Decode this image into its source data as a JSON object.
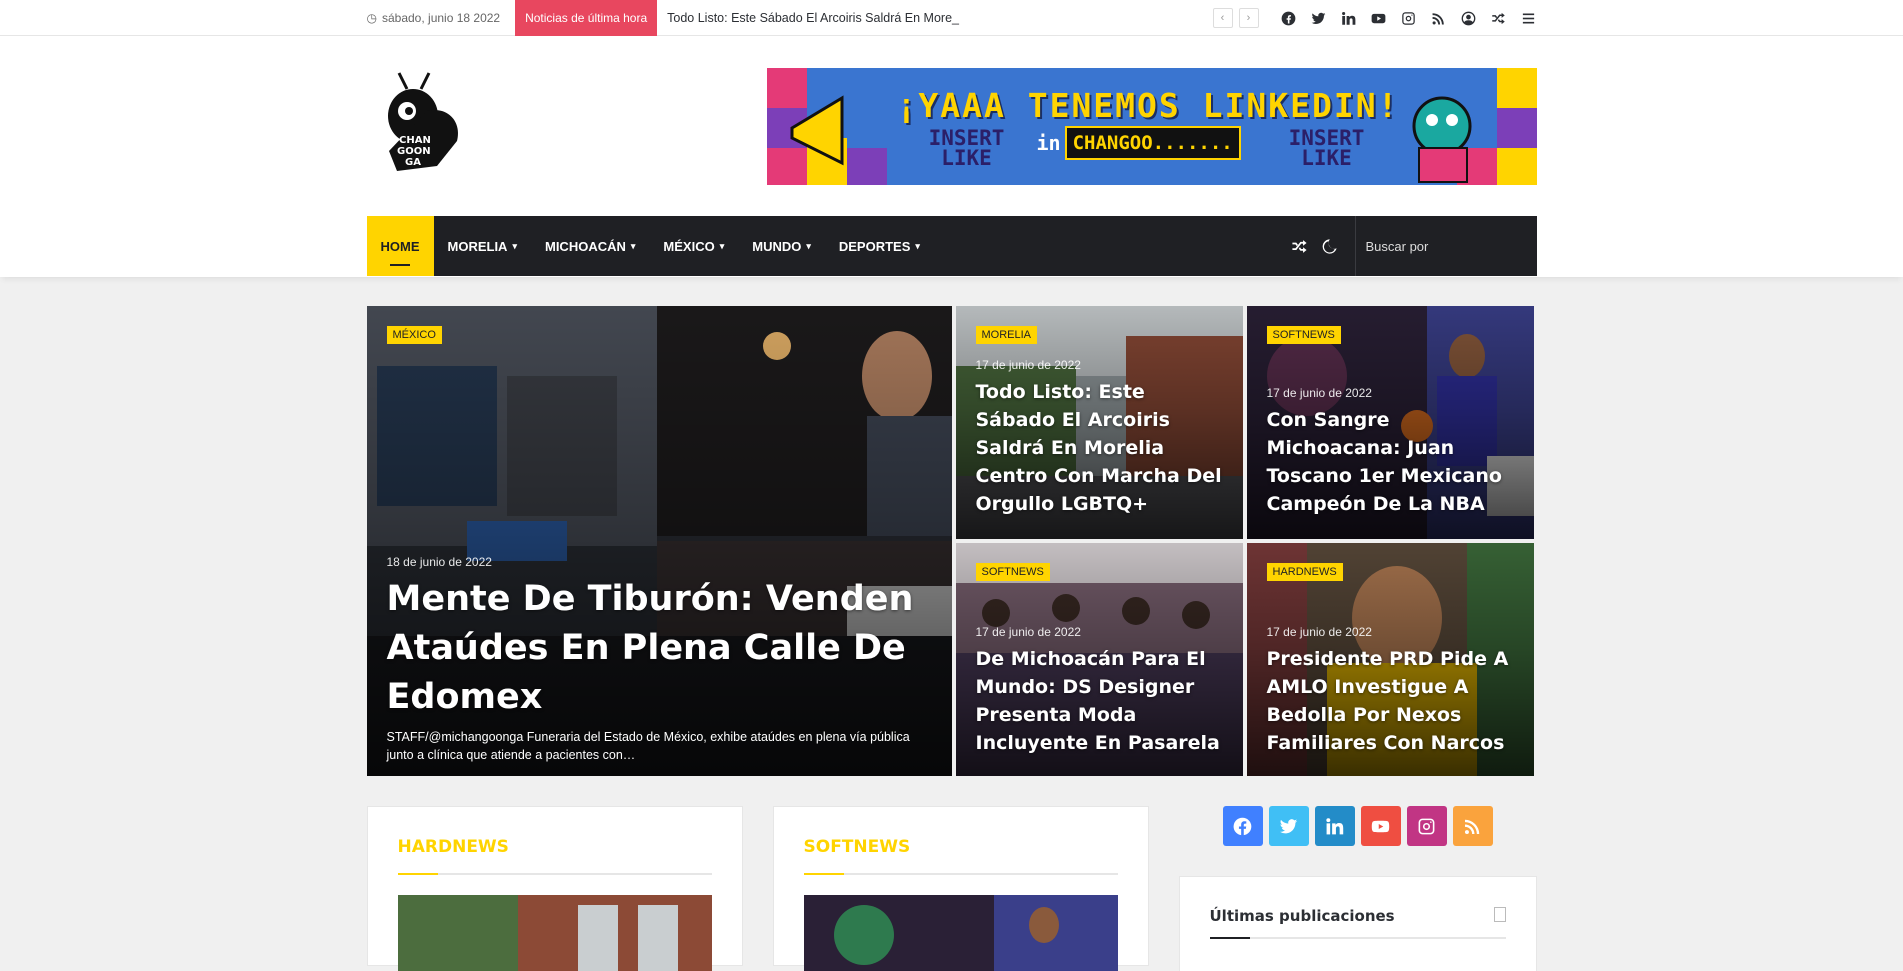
{
  "topbar": {
    "date": "sábado, junio 18 2022",
    "breaking_label": "Noticias de última hora",
    "breaking_text": "Todo Listo: Este Sábado El Arcoiris Saldrá En More_",
    "prev_arrow": "‹",
    "next_arrow": "›",
    "social_icons": [
      "facebook-icon",
      "twitter-icon",
      "linkedin-icon",
      "youtube-icon",
      "instagram-icon",
      "rss-icon",
      "user-icon",
      "random-icon",
      "menu-icon"
    ]
  },
  "header": {
    "logo_text": "CHAN GOON GA",
    "banner": {
      "title": "¡YAAA TENEMOS LINKEDIN!",
      "left_text": "INSERT LIKE",
      "right_text": "INSERT LIKE",
      "mid_in": "in",
      "mid_brand": "CHANGOO......."
    }
  },
  "nav": {
    "items": [
      {
        "label": "Home",
        "active": true,
        "caret": ""
      },
      {
        "label": "Morelia",
        "caret": "▾"
      },
      {
        "label": "Michoacán",
        "caret": "▾"
      },
      {
        "label": "México",
        "caret": "▾"
      },
      {
        "label": "Mundo",
        "caret": "▾"
      },
      {
        "label": "Deportes",
        "caret": "▾"
      }
    ],
    "search_placeholder": "Buscar por"
  },
  "featured": {
    "big": {
      "category": "México",
      "date": "18 de junio de 2022",
      "title": "Mente De Tiburón: Venden Ataúdes En Plena Calle De Edomex",
      "excerpt": "STAFF/@michangoonga Funeraria del Estado de México, exhibe ataúdes en plena vía pública junto a clínica que atiende a pacientes con…"
    },
    "small": [
      {
        "category": "Morelia",
        "date": "17 de junio de 2022",
        "title": "Todo Listo: Este Sábado El Arcoiris Saldrá En Morelia Centro Con Marcha Del Orgullo LGBTQ+"
      },
      {
        "category": "Softnews",
        "date": "17 de junio de 2022",
        "title": "Con Sangre Michoacana: Juan Toscano 1er Mexicano Campeón De La NBA"
      },
      {
        "category": "Softnews",
        "date": "17 de junio de 2022",
        "title": "De Michoacán Para El Mundo: DS Designer Presenta Moda Incluyente En Pasarela"
      },
      {
        "category": "Hardnews",
        "date": "17 de junio de 2022",
        "title": "Presidente PRD Pide A AMLO Investigue A Bedolla Por Nexos Familiares Con Narcos"
      }
    ]
  },
  "widgets": {
    "hardnews_title": "HARDNEWS",
    "softnews_title": "SOFTNEWS",
    "latest_title": "Últimas publicaciones"
  },
  "colors": {
    "accent": "#ffd400",
    "breaking": "#e8475f",
    "nav_bg": "#1f2024",
    "facebook": "#4080ff",
    "twitter": "#40bff5",
    "linkedin": "#238cc8",
    "youtube": "#ef4e41",
    "instagram": "#c13584",
    "rss": "#faa33d"
  }
}
